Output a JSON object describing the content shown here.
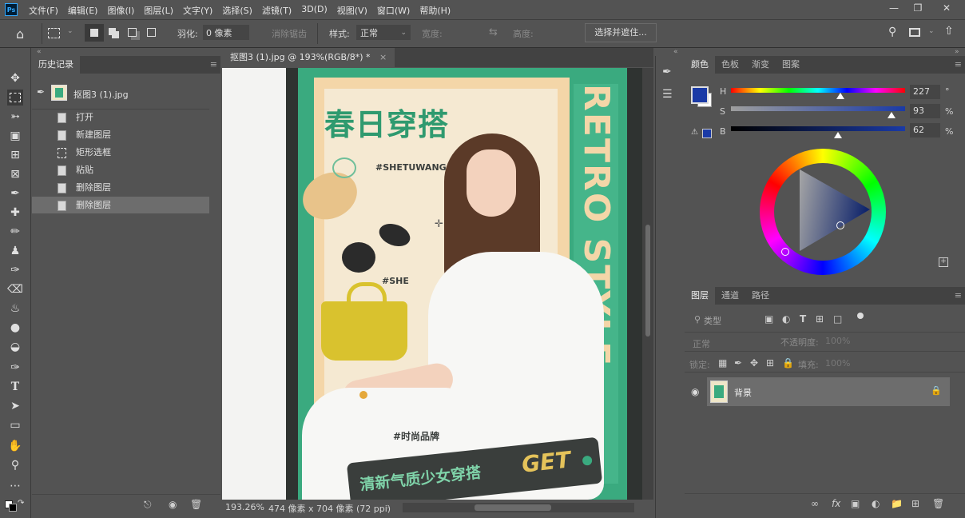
{
  "menubar": {
    "logo": "Ps",
    "items": [
      "文件(F)",
      "编辑(E)",
      "图像(I)",
      "图层(L)",
      "文字(Y)",
      "选择(S)",
      "滤镜(T)",
      "3D(D)",
      "视图(V)",
      "窗口(W)",
      "帮助(H)"
    ]
  },
  "options": {
    "feather_label": "羽化:",
    "feather_value": "0 像素",
    "antialias_label": "消除锯齿",
    "style_label": "样式:",
    "style_value": "正常",
    "width_label": "宽度:",
    "height_label": "高度:",
    "select_mask_button": "选择并遮住..."
  },
  "history": {
    "tab": "历史记录",
    "snapshot": "抠图3 (1).jpg",
    "items": [
      "打开",
      "新建图层",
      "矩形选框",
      "粘贴",
      "删除图层",
      "删除图层"
    ],
    "selected_index": 5
  },
  "document": {
    "tab_title": "抠图3 (1).jpg @ 193%(RGB/8*) *",
    "zoom": "193.26%",
    "dimensions": "474 像素 x 704 像素 (72 ppi)"
  },
  "poster": {
    "title": "春日穿搭",
    "hashtag1": "#SHETUWANG",
    "hashtag2": "#SHE",
    "brand_tag": "#时尚品牌",
    "vertical_text": "RETRO STYLE",
    "banner_text": "清新气质少女穿搭",
    "banner_get": "GET",
    "colors": {
      "green": "#3aaa7f",
      "peach": "#f4d6a8",
      "dark": "#3a3e3c",
      "yellow": "#d9c22e"
    }
  },
  "color_panel": {
    "tabs": [
      "颜色",
      "色板",
      "渐变",
      "图案"
    ],
    "active_tab": "颜色",
    "foreground_color": "#1a3aa6",
    "h_label": "H",
    "h_value": "227",
    "h_unit": "°",
    "s_label": "S",
    "s_value": "93",
    "s_unit": "%",
    "b_label": "B",
    "b_value": "62",
    "b_unit": "%"
  },
  "layers_panel": {
    "tabs": [
      "图层",
      "通道",
      "路径"
    ],
    "active_tab": "图层",
    "filter_label": "类型",
    "blend_mode": "正常",
    "opacity_label": "不透明度:",
    "opacity_value": "100%",
    "lock_label": "锁定:",
    "fill_label": "填充:",
    "fill_value": "100%",
    "layer_name": "背景"
  }
}
